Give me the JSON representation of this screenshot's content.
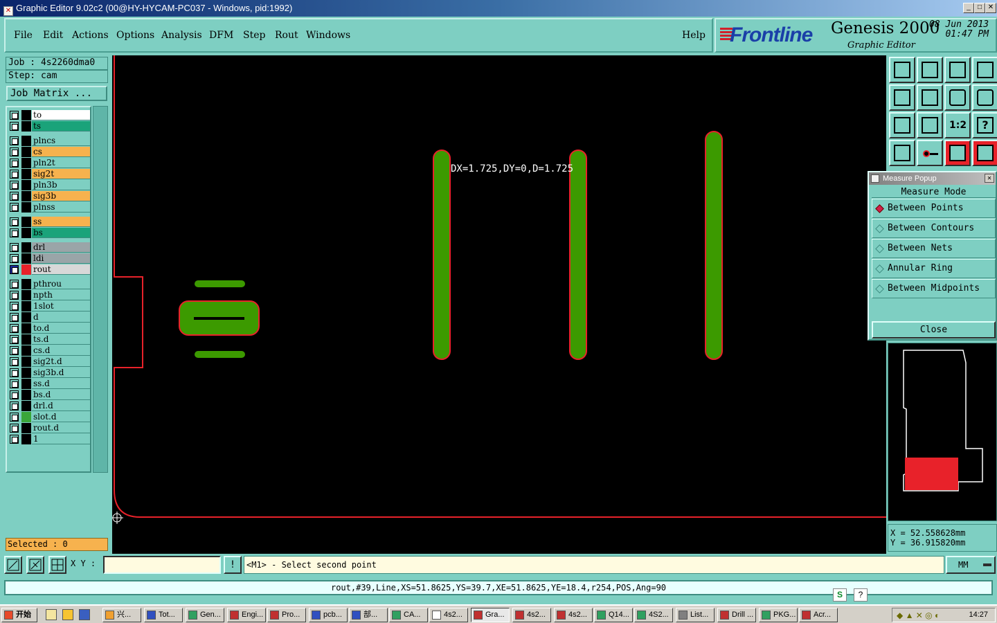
{
  "window": {
    "title": "Graphic Editor 9.02c2 (00@HY-HYCAM-PC037 - Windows, pid:1992)",
    "min": "_",
    "max": "□",
    "close": "✕"
  },
  "menu": {
    "items": [
      "File",
      "Edit",
      "Actions",
      "Options",
      "Analysis",
      "DFM",
      "Step",
      "Rout",
      "Windows"
    ],
    "help": "Help"
  },
  "brand": {
    "logo": "Frontline",
    "product": "Genesis 2000",
    "subtitle": "Graphic Editor",
    "date": "08 Jun 2013",
    "time": "01:47 PM"
  },
  "job": {
    "job": "Job : 4s2260dma0",
    "step": "Step: cam",
    "job_matrix": "Job Matrix ..."
  },
  "layers": [
    {
      "name": "to",
      "color": "#ffffff",
      "swatch": "#000000"
    },
    {
      "name": "ts",
      "color": "#1aa37a",
      "swatch": "#000000"
    },
    {
      "name": "plncs",
      "color": "#7ecfc2",
      "swatch": "#000000"
    },
    {
      "name": "cs",
      "color": "#f6b24e",
      "swatch": "#000000"
    },
    {
      "name": "pln2t",
      "color": "#7ecfc2",
      "swatch": "#000000"
    },
    {
      "name": "sig2t",
      "color": "#f6b24e",
      "swatch": "#000000"
    },
    {
      "name": "pln3b",
      "color": "#7ecfc2",
      "swatch": "#000000"
    },
    {
      "name": "sig3b",
      "color": "#f6b24e",
      "swatch": "#000000"
    },
    {
      "name": "plnss",
      "color": "#7ecfc2",
      "swatch": "#000000"
    },
    {
      "name": "ss",
      "color": "#f6b24e",
      "swatch": "#000000"
    },
    {
      "name": "bs",
      "color": "#1aa37a",
      "swatch": "#000000"
    },
    {
      "name": "drl",
      "color": "#9aa5a8",
      "swatch": "#000000"
    },
    {
      "name": "ldi",
      "color": "#9aa5a8",
      "swatch": "#000000"
    },
    {
      "name": "rout",
      "color": "#d8d8d8",
      "swatch": "#e8222a",
      "active": true
    },
    {
      "name": "pthrou",
      "color": "#7ecfc2",
      "swatch": "#000000"
    },
    {
      "name": "npth",
      "color": "#7ecfc2",
      "swatch": "#000000"
    },
    {
      "name": "1slot",
      "color": "#7ecfc2",
      "swatch": "#000000"
    },
    {
      "name": "d",
      "color": "#7ecfc2",
      "swatch": "#000000"
    },
    {
      "name": "to.d",
      "color": "#7ecfc2",
      "swatch": "#000000"
    },
    {
      "name": "ts.d",
      "color": "#7ecfc2",
      "swatch": "#000000"
    },
    {
      "name": "cs.d",
      "color": "#7ecfc2",
      "swatch": "#000000"
    },
    {
      "name": "sig2t.d",
      "color": "#7ecfc2",
      "swatch": "#000000"
    },
    {
      "name": "sig3b.d",
      "color": "#7ecfc2",
      "swatch": "#000000"
    },
    {
      "name": "ss.d",
      "color": "#7ecfc2",
      "swatch": "#000000"
    },
    {
      "name": "bs.d",
      "color": "#7ecfc2",
      "swatch": "#000000"
    },
    {
      "name": "drl.d",
      "color": "#7ecfc2",
      "swatch": "#000000"
    },
    {
      "name": "slot.d",
      "color": "#7ecfc2",
      "swatch": "#3aa63a"
    },
    {
      "name": "rout.d",
      "color": "#7ecfc2",
      "swatch": "#000000"
    },
    {
      "name": "1",
      "color": "#7ecfc2",
      "swatch": "#000000"
    }
  ],
  "selected": "Selected : 0",
  "canvas": {
    "measure_text": "DX=1.725,DY=0,D=1.725",
    "pad_color": "#3c9a00",
    "outline_color": "#e8222a"
  },
  "tools": [
    "up-icon",
    "down-icon",
    "home-icon",
    "window-icon",
    "left-icon",
    "right-icon",
    "undo-icon",
    "s-icon",
    "fit-icon",
    "zoom-icon",
    "1to2-icon",
    "help-icon",
    "settings-icon",
    "probe-icon",
    "layer-red-icon",
    "layer-red2-icon"
  ],
  "tool_1to2": "1:2",
  "tool_help": "?",
  "measure_popup": {
    "title": "Measure Popup",
    "header": "Measure Mode",
    "options": [
      {
        "label": "Between Points",
        "selected": true
      },
      {
        "label": "Between Contours",
        "selected": false
      },
      {
        "label": "Between Nets",
        "selected": false
      },
      {
        "label": "Annular Ring",
        "selected": false
      },
      {
        "label": "Between Midpoints",
        "selected": false
      }
    ],
    "close": "Close"
  },
  "coords": {
    "x": "X  =  52.558628mm",
    "y": "Y  =  36.915820mm"
  },
  "cmd": {
    "xy_label": "X Y :",
    "xy_value": "",
    "prompt": "<M1> - Select second point",
    "unit": "MM",
    "bang": "!"
  },
  "status": "rout,#39,Line,XS=51.8625,YS=39.7,XE=51.8625,YE=18.4,r254,POS,Ang=90",
  "taskbar": {
    "start": "开始",
    "tasks": [
      "兴...",
      "Tot...",
      "Gen...",
      "Engi...",
      "Pro...",
      "pcb...",
      "部...",
      "CA...",
      "4s2...",
      "Gra...",
      "4s2...",
      "4s2...",
      "Q14...",
      "4S2...",
      "List...",
      "Drill ...",
      "PKG...",
      "Acr..."
    ],
    "clock": "14:27"
  }
}
